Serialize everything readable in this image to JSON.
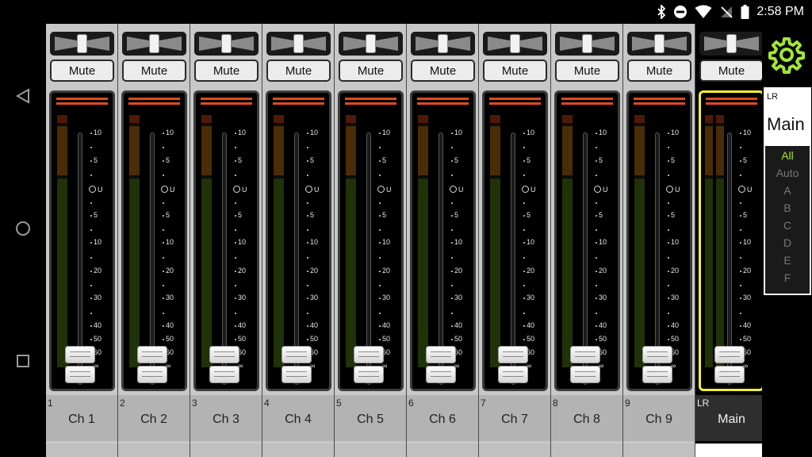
{
  "status": {
    "time": "2:58 PM"
  },
  "strips": [
    {
      "num": "1",
      "name": "Ch 1",
      "mute": "Mute",
      "main": false
    },
    {
      "num": "2",
      "name": "Ch 2",
      "mute": "Mute",
      "main": false
    },
    {
      "num": "3",
      "name": "Ch 3",
      "mute": "Mute",
      "main": false
    },
    {
      "num": "4",
      "name": "Ch 4",
      "mute": "Mute",
      "main": false
    },
    {
      "num": "5",
      "name": "Ch 5",
      "mute": "Mute",
      "main": false
    },
    {
      "num": "6",
      "name": "Ch 6",
      "mute": "Mute",
      "main": false
    },
    {
      "num": "7",
      "name": "Ch 7",
      "mute": "Mute",
      "main": false
    },
    {
      "num": "8",
      "name": "Ch 8",
      "mute": "Mute",
      "main": false
    },
    {
      "num": "9",
      "name": "Ch 9",
      "mute": "Mute",
      "main": false
    },
    {
      "num": "LR",
      "name": "Main",
      "mute": "Mute",
      "main": true
    }
  ],
  "scale_labels": [
    "10",
    "5",
    "U",
    "5",
    "10",
    "20",
    "30",
    "40",
    "50",
    "60",
    "∞"
  ],
  "bus": {
    "small": "LR",
    "big": "Main",
    "filters": [
      "All",
      "Auto",
      "A",
      "B",
      "C",
      "D",
      "E",
      "F"
    ],
    "active_filter": "All"
  },
  "colors": {
    "accent": "#a2e634",
    "selected_border": "#f2ee33",
    "clip": "#e04a1e"
  },
  "icons": {
    "back": "back-triangle-icon",
    "home": "home-circle-icon",
    "recents": "recents-square-icon",
    "settings": "gear-icon"
  }
}
